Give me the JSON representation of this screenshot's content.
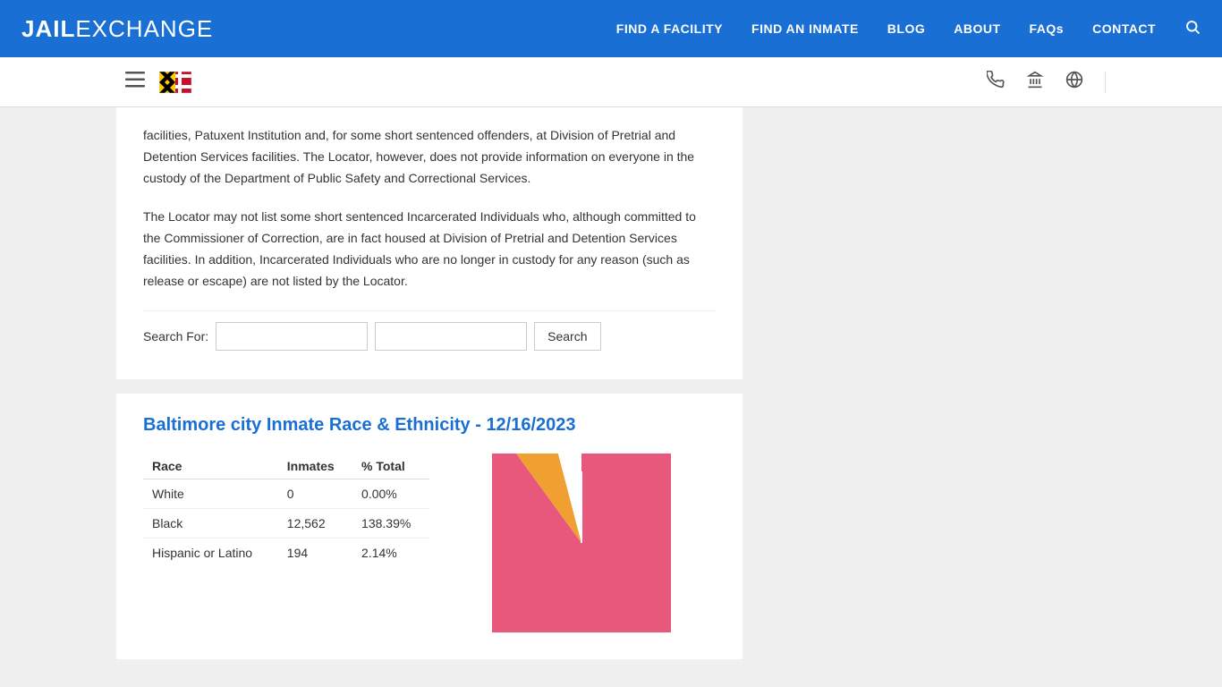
{
  "navbar": {
    "brand_jail": "JAIL",
    "brand_exchange": "EXCHANGE",
    "links": [
      {
        "id": "find-facility",
        "label": "FIND A FACILITY"
      },
      {
        "id": "find-inmate",
        "label": "FIND AN INMATE"
      },
      {
        "id": "blog",
        "label": "BLOG"
      },
      {
        "id": "about",
        "label": "ABOUT"
      },
      {
        "id": "faqs",
        "label": "FAQs"
      },
      {
        "id": "contact",
        "label": "CONTACT"
      }
    ]
  },
  "subheader": {
    "phone_icon": "📞",
    "bank_icon": "🏛",
    "globe_icon": "🌐"
  },
  "content": {
    "paragraph1": "facilities, Patuxent Institution and, for some short sentenced offenders, at Division of Pretrial and Detention Services facilities. The Locator, however, does not provide information on everyone in the custody of the Department of Public Safety and Correctional Services.",
    "paragraph2": "The Locator may not list some short sentenced Incarcerated Individuals who, although committed to the Commissioner of Correction, are in fact housed at Division of Pretrial and Detention Services facilities. In addition, Incarcerated Individuals who are no longer in custody for any reason (such as release or escape) are not listed by the Locator."
  },
  "search": {
    "label": "Search For:",
    "input1_placeholder": "",
    "input2_placeholder": "",
    "button_label": "Search"
  },
  "stats": {
    "title": "Baltimore city Inmate Race & Ethnicity - 12/16/2023",
    "columns": [
      "Race",
      "Inmates",
      "% Total"
    ],
    "rows": [
      {
        "race": "White",
        "inmates": "0",
        "pct": "0.00%"
      },
      {
        "race": "Black",
        "inmates": "12,562",
        "pct": "138.39%"
      },
      {
        "race": "Hispanic or Latino",
        "inmates": "194",
        "pct": "2.14%"
      }
    ],
    "chart": {
      "pink_pct": 92,
      "orange_pct": 5,
      "white_pct": 3
    }
  }
}
